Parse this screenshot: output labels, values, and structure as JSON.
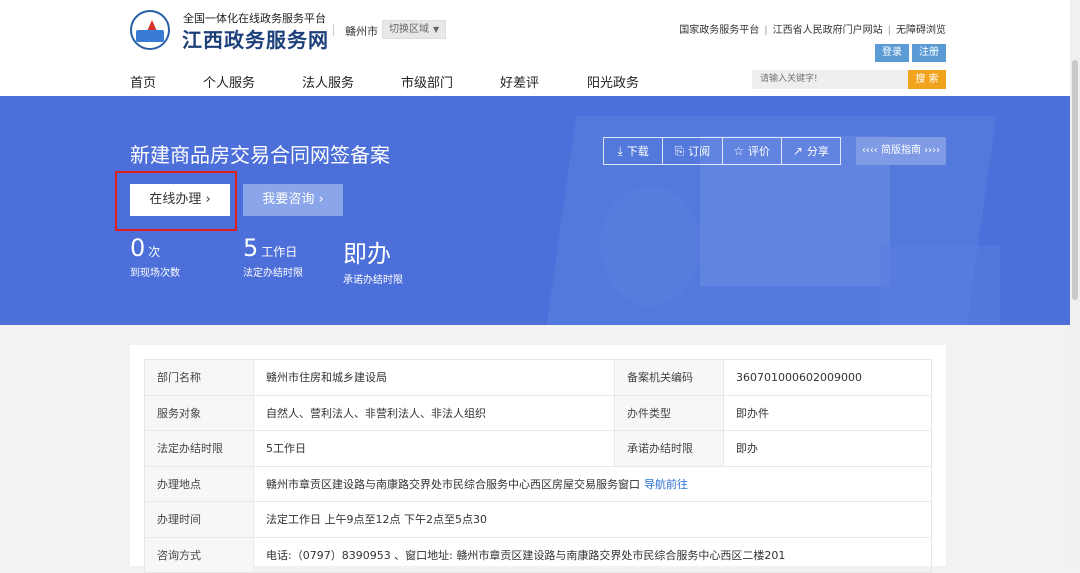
{
  "header": {
    "site_subtitle": "全国一体化在线政务服务平台",
    "site_title": "江西政务服务网",
    "city": "赣州市",
    "switch_region": "切换区域",
    "top_links": [
      "国家政务服务平台",
      "江西省人民政府门户网站",
      "无障碍浏览"
    ],
    "login": "登录",
    "register": "注册",
    "nav": [
      "首页",
      "个人服务",
      "法人服务",
      "市级部门",
      "好差评",
      "阳光政务"
    ],
    "search_placeholder": "请输入关键字!",
    "search_button": "搜 索"
  },
  "banner": {
    "title": "新建商品房交易合同网签备案",
    "actions": [
      {
        "icon": "download-icon",
        "label": "下载"
      },
      {
        "icon": "subscribe-icon",
        "label": "订阅"
      },
      {
        "icon": "star-icon",
        "label": "评价"
      },
      {
        "icon": "share-icon",
        "label": "分享"
      }
    ],
    "guide_button": "‹‹‹‹ 简版指南 ››››",
    "online_button": "在线办理",
    "consult_button": "我要咨询",
    "stats": [
      {
        "value": "0",
        "unit": "次",
        "label": "到现场次数"
      },
      {
        "value": "5",
        "unit": "工作日",
        "label": "法定办结时限"
      },
      {
        "value": "即办",
        "unit": "",
        "label": "承诺办结时限"
      }
    ]
  },
  "info": {
    "dept_label": "部门名称",
    "dept_value": "赣州市住房和城乡建设局",
    "code_label": "备案机关编码",
    "code_value": "360701000602009000",
    "target_label": "服务对象",
    "target_value": "自然人、营利法人、非营利法人、非法人组织",
    "type_label": "办件类型",
    "type_value": "即办件",
    "legal_label": "法定办结时限",
    "legal_value": "5工作日",
    "promise_label": "承诺办结时限",
    "promise_value": "即办",
    "place_label": "办理地点",
    "place_value": "赣州市章贡区建设路与南康路交界处市民综合服务中心西区房屋交易服务窗口",
    "place_link": "导航前往",
    "time_label": "办理时间",
    "time_value": "法定工作日 上午9点至12点 下午2点至5点30",
    "consult_label": "咨询方式",
    "consult_value": "电话:（0797）8390953 、窗口地址: 赣州市章贡区建设路与南康路交界处市民综合服务中心西区二楼201"
  }
}
